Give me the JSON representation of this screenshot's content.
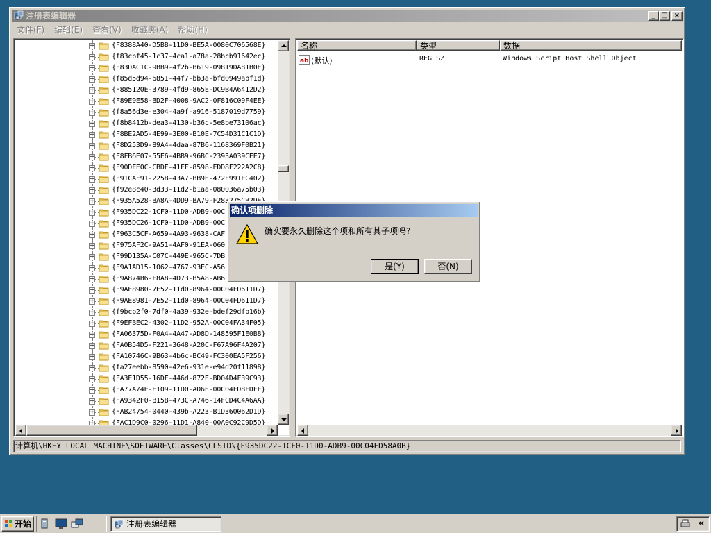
{
  "window": {
    "title": "注册表编辑器",
    "menu": [
      "文件(F)",
      "编辑(E)",
      "查看(V)",
      "收藏夹(A)",
      "帮助(H)"
    ],
    "minimize_glyph": "_",
    "maximize_glyph": "□",
    "close_glyph": "×"
  },
  "tree": {
    "keys": [
      "{F8388A40-D5BB-11D0-BE5A-0080C706568E}",
      "{f83cbf45-1c37-4ca1-a78a-28bcb91642ec}",
      "{F83DAC1C-9BB9-4f2b-B619-09819DA81B0E}",
      "{f85d5d94-6851-44f7-bb3a-bfd0949abf1d}",
      "{F885120E-3789-4fd9-865E-DC9B4A6412D2}",
      "{F89E9E58-BD2F-4008-9AC2-0F816C09F4EE}",
      "{f8a56d3e-e304-4a9f-a916-5187019d7759}",
      "{f8b8412b-dea3-4130-b36c-5e8be73106ac}",
      "{F8BE2AD5-4E99-3E00-B10E-7C54D31C1C1D}",
      "{F8D253D9-89A4-4daa-87B6-1168369F0B21}",
      "{F8FB6E07-55E6-4BB9-96BC-2393A039CEE7}",
      "{F90DFE0C-CBDF-41FF-8598-EDD8F222A2C8}",
      "{F91CAF91-225B-43A7-BB9E-472F991FC402}",
      "{f92e8c40-3d33-11d2-b1aa-080036a75b03}",
      "{F935A528-BA8A-4DD9-BA79-F283275CB2DE}",
      "{F935DC22-1CF0-11D0-ADB9-00C",
      "{F935DC26-1CF0-11D0-ADB9-00C",
      "{F963C5CF-A659-4A93-9638-CAF",
      "{F975AF2C-9A51-4AF0-91EA-060",
      "{F99D135A-C07C-449E-965C-7DB",
      "{F9A1AD15-1062-4767-93EC-A56",
      "{F9A874B6-F8A8-4D73-B5A8-AB6",
      "{F9AE8980-7E52-11d0-8964-00C04FD611D7}",
      "{F9AE8981-7E52-11d0-8964-00C04FD611D7}",
      "{f9bcb2f0-7df0-4a39-932e-bdef29dfb16b}",
      "{F9EFBEC2-4302-11D2-952A-00C04FA34F05}",
      "{FA06375D-F0A4-4A47-AD8D-148595F1E0B8}",
      "{FA0B54D5-F221-3648-A20C-F67A96F4A207}",
      "{FA10746C-9B63-4b6c-BC49-FC300EA5F256}",
      "{fa27eebb-8590-42e6-931e-e94d20f11898}",
      "{FA3E1D55-16DF-446d-872E-BD04D4F39C93}",
      "{FA77A74E-E109-11D0-AD6E-00C04FD8FDFF}",
      "{FA9342F0-B15B-473C-A746-14FCD4C4A6AA}",
      "{FAB24754-0440-439b-A223-B1D360062D1D}",
      "{FAC1D9C0-0296-11D1-A840-00A0C92C9D5D}"
    ]
  },
  "list": {
    "columns": [
      "名称",
      "类型",
      "数据"
    ],
    "rows": [
      {
        "name": "(默认)",
        "type": "REG_SZ",
        "data": "Windows Script Host Shell Object",
        "icon": "ab-string-icon"
      }
    ]
  },
  "status": {
    "path": "计算机\\HKEY_LOCAL_MACHINE\\SOFTWARE\\Classes\\CLSID\\{F935DC22-1CF0-11D0-ADB9-00C04FD58A0B}"
  },
  "dialog": {
    "title": "确认项删除",
    "message": "确实要永久删除这个项和所有其子项吗?",
    "yes_label": "是(Y)",
    "no_label": "否(N)",
    "icon": "warning-icon"
  },
  "taskbar": {
    "start_label": "开始",
    "task_label": "注册表编辑器",
    "tray_chevron": "«"
  },
  "colors": {
    "desktop": "#215f85",
    "dialog_title": "#0a246a",
    "inactive_title": "#808080"
  }
}
